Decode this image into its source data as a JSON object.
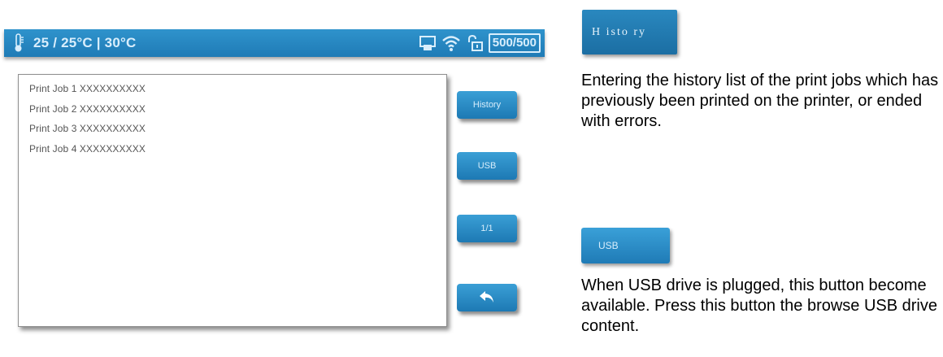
{
  "status_bar": {
    "temperature": "25 / 25°C | 30°C",
    "counter": "500/500"
  },
  "job_list": {
    "items": [
      "Print Job 1 XXXXXXXXXX",
      "Print Job 2 XXXXXXXXXX",
      "Print Job 3 XXXXXXXXXX",
      "Print Job 4 XXXXXXXXXX"
    ]
  },
  "buttons": {
    "history": "History",
    "usb": "USB",
    "page": "1/1"
  },
  "annotations": {
    "history_button_label": "H isto ry",
    "history_text": "Entering the history list of the print jobs which has previously been printed on the printer, or ended with errors.",
    "usb_button_label": "USB",
    "usb_text": "When USB drive is plugged, this button become available. Press this button the browse USB drive content."
  },
  "icons": {
    "thermometer": "thermometer-icon",
    "printer": "printer-icon",
    "wifi": "wifi-icon",
    "lock": "unlock-icon",
    "back": "back-arrow-icon"
  },
  "colors": {
    "accent": "#1f7bb6",
    "accent_light": "#3a9fd6"
  }
}
